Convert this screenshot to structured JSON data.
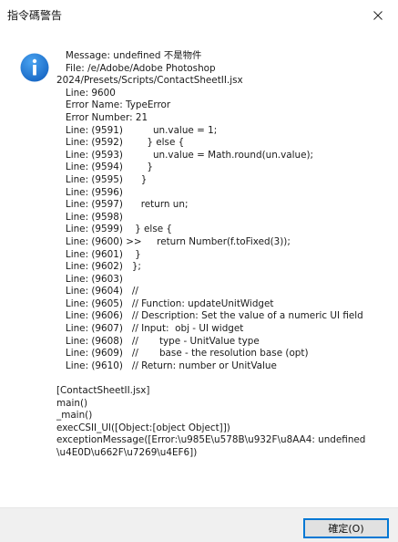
{
  "window": {
    "title": "指令碼警告"
  },
  "icon": {
    "name": "info-icon",
    "color": "#1a73d2"
  },
  "message_lines_1": [
    "   Message: undefined 不是物件",
    "   File: /e/Adobe/Adobe Photoshop",
    "2024/Presets/Scripts/ContactSheetII.jsx",
    "   Line: 9600",
    "   Error Name: TypeError",
    "   Error Number: 21",
    "   Line: (9591)          un.value = 1;",
    "   Line: (9592)        } else {",
    "   Line: (9593)          un.value = Math.round(un.value);",
    "   Line: (9594)        }",
    "   Line: (9595)      }",
    "   Line: (9596)",
    "   Line: (9597)      return un;",
    "   Line: (9598)",
    "   Line: (9599)    } else {",
    "   Line: (9600) >>     return Number(f.toFixed(3));",
    "   Line: (9601)    }",
    "   Line: (9602)   };",
    "   Line: (9603)",
    "   Line: (9604)   //",
    "   Line: (9605)   // Function: updateUnitWidget",
    "   Line: (9606)   // Description: Set the value of a numeric UI field",
    "   Line: (9607)   // Input:  obj - UI widget",
    "   Line: (9608)   //       type - UnitValue type",
    "   Line: (9609)   //       base - the resolution base (opt)",
    "   Line: (9610)   // Return: number or UnitValue"
  ],
  "message_lines_2": [
    "[ContactSheetII.jsx]",
    "main()",
    "_main()",
    "execCSII_UI([Object:[object Object]])",
    "exceptionMessage([Error:\\u985E\\u578B\\u932F\\u8AA4: undefined",
    "\\u4E0D\\u662F\\u7269\\u4EF6])"
  ],
  "buttons": {
    "ok_label": "確定(O)"
  }
}
